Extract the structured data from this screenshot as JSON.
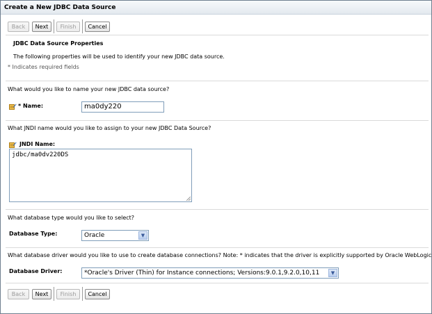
{
  "window": {
    "title": "Create a New JDBC Data Source"
  },
  "toolbar": {
    "back": "Back",
    "next": "Next",
    "finish": "Finish",
    "cancel": "Cancel"
  },
  "section": {
    "title": "JDBC Data Source Properties",
    "description": "The following properties will be used to identify your new JDBC data source.",
    "required_note": "* Indicates required fields"
  },
  "name_field": {
    "question": "What would you like to name your new JDBC data source?",
    "label": "* Name:",
    "value": "ma0dy220"
  },
  "jndi_field": {
    "question": "What JNDI name would you like to assign to your new JDBC Data Source?",
    "label": "JNDI Name:",
    "value": "jdbc/ma0dv220DS"
  },
  "db_type": {
    "question": "What database type would you like to select?",
    "label": "Database Type:",
    "selected": "Oracle"
  },
  "db_driver": {
    "question": "What database driver would you like to use to create database connections? Note: * indicates that the driver is explicitly supported by Oracle WebLogic Server.",
    "label": "Database Driver:",
    "selected": "*Oracle's Driver (Thin) for Instance connections; Versions:9.0.1,9.2.0,10,11"
  },
  "icons": {
    "field_help": "edit-field-icon",
    "dropdown": "chevron-down-icon"
  },
  "colors": {
    "border": "#6f7f8f",
    "title_bar": "#e3e9ef",
    "input_border": "#7f9db9"
  }
}
